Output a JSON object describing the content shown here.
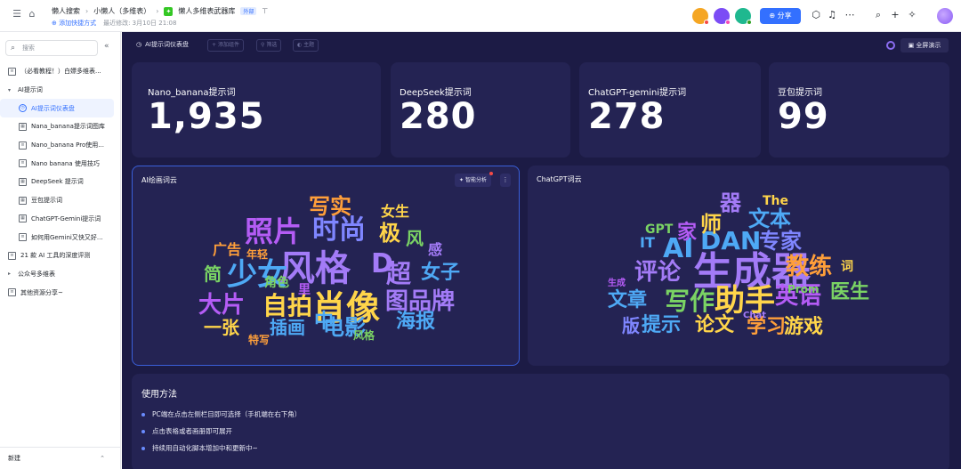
{
  "header": {
    "breadcrumbs": [
      "懒人搜索",
      "小懒人（多维表）",
      "懒人多维表武器库"
    ],
    "share_tag": "外部",
    "add_shortcut": "添加快捷方式",
    "last_modified": "最近修改: 3月10日 21:08",
    "share_label": "分享"
  },
  "sidebar": {
    "search_placeholder": "搜索",
    "items": [
      {
        "label": "（必看教程！）白嫖多维表..."
      },
      {
        "label": "AI提示词"
      },
      {
        "label": "AI提示词仪表盘"
      },
      {
        "label": "Nana_banana提示词图库"
      },
      {
        "label": "Nano_banana Pro使用..."
      },
      {
        "label": "Nano banana 使用技巧"
      },
      {
        "label": "DeepSeek 提示词"
      },
      {
        "label": "豆包提示词"
      },
      {
        "label": "ChatGPT-Gemini提示词"
      },
      {
        "label": "如何用Gemini又快又好..."
      },
      {
        "label": "21 款 AI 工具的深度评测"
      },
      {
        "label": "公众号多维表"
      },
      {
        "label": "其他资源分享~"
      }
    ],
    "new_label": "新建"
  },
  "toolbar": {
    "title": "AI提示词仪表盘",
    "add_component": "添加组件",
    "filter": "筛选",
    "theme": "主题",
    "present": "全屏演示"
  },
  "stats": [
    {
      "label": "Nano_banana提示词",
      "value": "1,935"
    },
    {
      "label": "DeepSeek提示词",
      "value": "280"
    },
    {
      "label": "ChatGPT-gemini提示词",
      "value": "278"
    },
    {
      "label": "豆包提示词",
      "value": "99"
    }
  ],
  "wordcloud_ai": {
    "title": "AI绘画词云",
    "smart_button": "智能分析",
    "words": [
      {
        "t": "风格",
        "c": "#a37bf7"
      },
      {
        "t": "D",
        "c": "#a37bf7"
      },
      {
        "t": "少女",
        "c": "#4ea9f5"
      },
      {
        "t": "肖像",
        "c": "#ffd54a"
      },
      {
        "t": "照片",
        "c": "#b45cf5"
      },
      {
        "t": "时尚",
        "c": "#7f86ff"
      },
      {
        "t": "写实",
        "c": "#ff9f3a"
      },
      {
        "t": "极",
        "c": "#ffd54a"
      },
      {
        "t": "风",
        "c": "#7ad364"
      },
      {
        "t": "女生",
        "c": "#ffd54a"
      },
      {
        "t": "超",
        "c": "#a37bf7"
      },
      {
        "t": "女子",
        "c": "#4ea9f5"
      },
      {
        "t": "自拍",
        "c": "#ffd54a"
      },
      {
        "t": "大片",
        "c": "#b45cf5"
      },
      {
        "t": "图品牌",
        "c": "#a37bf7"
      },
      {
        "t": "海报",
        "c": "#4ea9f5"
      },
      {
        "t": "电影",
        "c": "#4ea9f5"
      },
      {
        "t": "插画",
        "c": "#4ea9f5"
      },
      {
        "t": "一张",
        "c": "#ffd54a"
      },
      {
        "t": "简",
        "c": "#7ad364"
      },
      {
        "t": "中",
        "c": "#4ea9f5"
      },
      {
        "t": "感",
        "c": "#a37bf7"
      },
      {
        "t": "广告",
        "c": "#ff9f3a"
      },
      {
        "t": "年轻",
        "c": "#ff9f3a"
      },
      {
        "t": "角色",
        "c": "#7ad364"
      },
      {
        "t": "特写",
        "c": "#ff9f3a"
      },
      {
        "t": "风格",
        "c": "#7ad364"
      },
      {
        "t": "里",
        "c": "#b45cf5"
      }
    ]
  },
  "wordcloud_gpt": {
    "title": "ChatGPT词云",
    "words": [
      {
        "t": "生成器",
        "c": "#a37bf7"
      },
      {
        "t": "DAN",
        "c": "#4ea9f5"
      },
      {
        "t": "专家",
        "c": "#7f86ff"
      },
      {
        "t": "AI",
        "c": "#4ea9f5"
      },
      {
        "t": "助手",
        "c": "#ffd54a"
      },
      {
        "t": "写作",
        "c": "#7ad364"
      },
      {
        "t": "评论",
        "c": "#a37bf7"
      },
      {
        "t": "教练",
        "c": "#ff9f3a"
      },
      {
        "t": "英语",
        "c": "#b45cf5"
      },
      {
        "t": "文本",
        "c": "#4ea9f5"
      },
      {
        "t": "师",
        "c": "#ffd54a"
      },
      {
        "t": "器",
        "c": "#a37bf7"
      },
      {
        "t": "家",
        "c": "#b45cf5"
      },
      {
        "t": "IT",
        "c": "#4ea9f5"
      },
      {
        "t": "GPT",
        "c": "#7ad364"
      },
      {
        "t": "文章",
        "c": "#4ea9f5"
      },
      {
        "t": "论文",
        "c": "#ffd54a"
      },
      {
        "t": "提示",
        "c": "#4ea9f5"
      },
      {
        "t": "学习",
        "c": "#ff9f3a"
      },
      {
        "t": "游戏",
        "c": "#ffd54a"
      },
      {
        "t": "版",
        "c": "#7f86ff"
      },
      {
        "t": "医生",
        "c": "#7ad364"
      },
      {
        "t": "The",
        "c": "#ffd54a"
      },
      {
        "t": "Prom",
        "c": "#7ad364"
      },
      {
        "t": "词",
        "c": "#ffd54a"
      },
      {
        "t": "生成",
        "c": "#b45cf5"
      },
      {
        "t": "Chat",
        "c": "#a37bf7"
      }
    ]
  },
  "usage": {
    "title": "使用方法",
    "items": [
      "PC端在点击左侧栏目即可选择（手机端在右下角）",
      "点击表格或者画册即可展开",
      "持续用自动化脚本增加中和更新中~"
    ]
  }
}
